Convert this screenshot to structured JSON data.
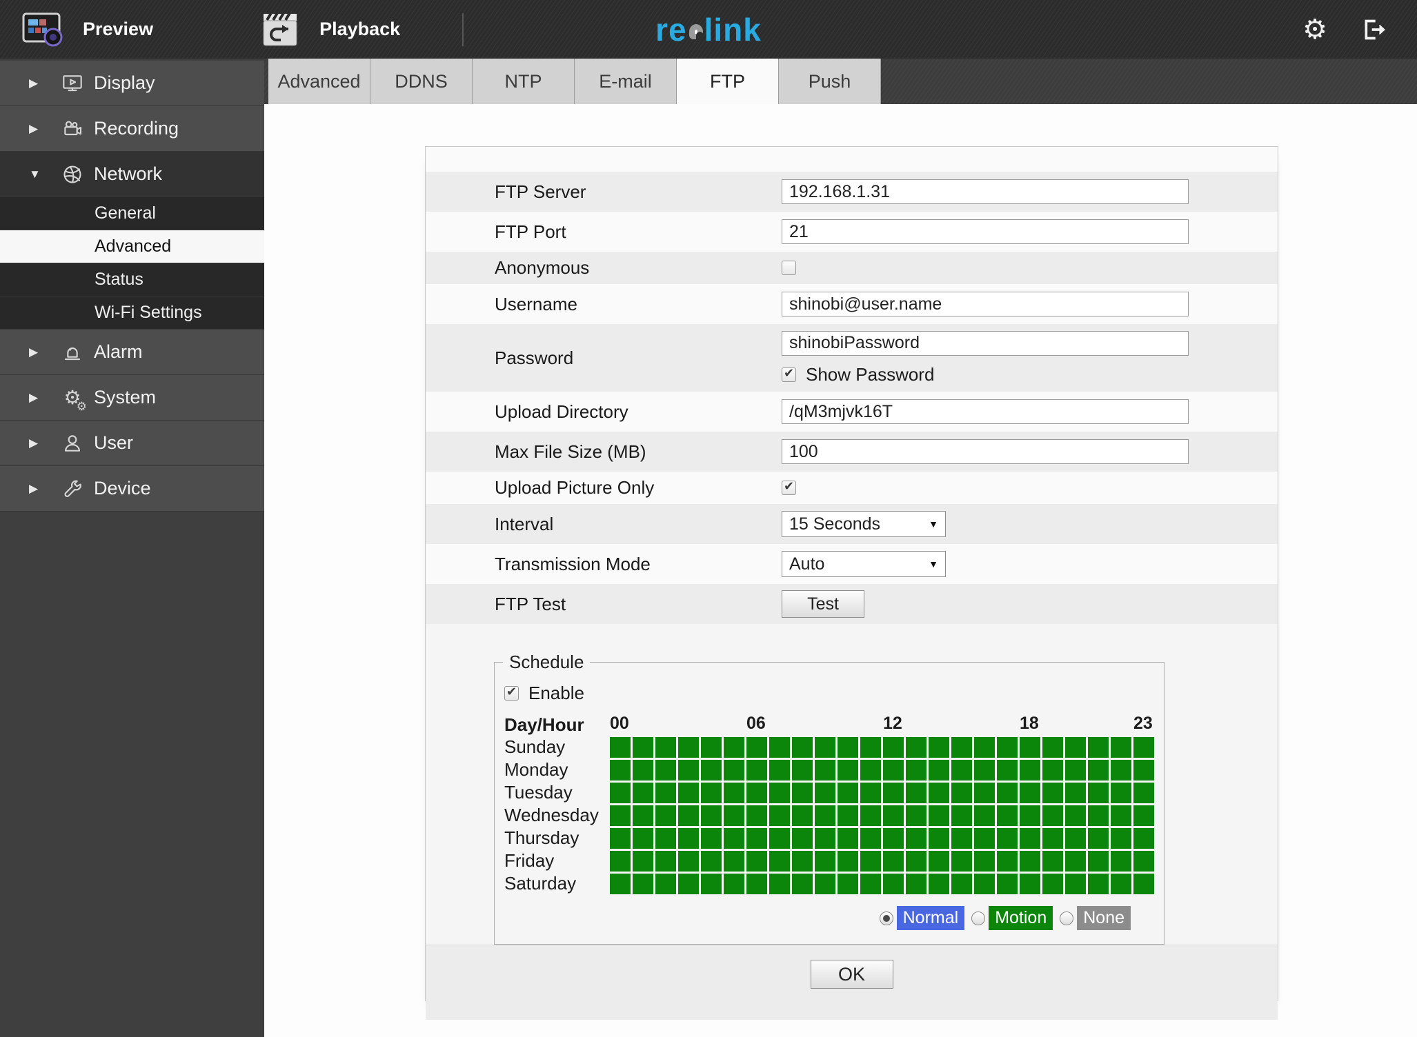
{
  "topbar": {
    "preview_label": "Preview",
    "playback_label": "Playback",
    "logo_re": "re",
    "logo_link": "link"
  },
  "sidebar": {
    "items": [
      {
        "label": "Display",
        "icon": "display",
        "expanded": false
      },
      {
        "label": "Recording",
        "icon": "recording",
        "expanded": false
      },
      {
        "label": "Network",
        "icon": "network",
        "expanded": true,
        "children": [
          {
            "label": "General",
            "active": false
          },
          {
            "label": "Advanced",
            "active": true
          },
          {
            "label": "Status",
            "active": false
          },
          {
            "label": "Wi-Fi Settings",
            "active": false
          }
        ]
      },
      {
        "label": "Alarm",
        "icon": "alarm",
        "expanded": false
      },
      {
        "label": "System",
        "icon": "system",
        "expanded": false
      },
      {
        "label": "User",
        "icon": "user",
        "expanded": false
      },
      {
        "label": "Device",
        "icon": "device",
        "expanded": false
      }
    ]
  },
  "tabs": {
    "active": "FTP",
    "items": [
      "Advanced",
      "DDNS",
      "NTP",
      "E-mail",
      "FTP",
      "Push"
    ]
  },
  "form": {
    "rows": [
      {
        "id": "ftp-server",
        "label": "FTP Server",
        "type": "text",
        "value": "192.168.1.31"
      },
      {
        "id": "ftp-port",
        "label": "FTP Port",
        "type": "text",
        "value": "21"
      },
      {
        "id": "anonymous",
        "label": "Anonymous",
        "type": "checkbox",
        "checked": false
      },
      {
        "id": "username",
        "label": "Username",
        "type": "text",
        "value": "shinobi@user.name"
      },
      {
        "id": "password",
        "label": "Password",
        "type": "password",
        "value": "shinobiPassword",
        "sub_label": "Show Password",
        "sub_checked": true
      },
      {
        "id": "upload-directory",
        "label": "Upload Directory",
        "type": "text",
        "value": "/qM3mjvk16T"
      },
      {
        "id": "max-file-size",
        "label": "Max File Size (MB)",
        "type": "text",
        "value": "100"
      },
      {
        "id": "upload-picture-only",
        "label": "Upload Picture Only",
        "type": "checkbox",
        "checked": true
      },
      {
        "id": "interval",
        "label": "Interval",
        "type": "select",
        "value": "15 Seconds"
      },
      {
        "id": "transmission-mode",
        "label": "Transmission Mode",
        "type": "select",
        "value": "Auto"
      },
      {
        "id": "ftp-test",
        "label": "FTP Test",
        "type": "button",
        "value": "Test"
      }
    ]
  },
  "schedule": {
    "legend": "Schedule",
    "enable_label": "Enable",
    "enabled": true,
    "corner_label": "Day/Hour",
    "columns": 24,
    "hour_labels": [
      {
        "text": "00",
        "col": 0
      },
      {
        "text": "06",
        "col": 6
      },
      {
        "text": "12",
        "col": 12
      },
      {
        "text": "18",
        "col": 18
      },
      {
        "text": "23",
        "col": 23
      }
    ],
    "days": [
      "Sunday",
      "Monday",
      "Tuesday",
      "Wednesday",
      "Thursday",
      "Friday",
      "Saturday"
    ],
    "all_cells_mode": "motion",
    "modes": [
      {
        "label": "Normal",
        "color": "#4a67e2",
        "selected": true
      },
      {
        "label": "Motion",
        "color": "#0b860b",
        "selected": false
      },
      {
        "label": "None",
        "color": "#8c8c8c",
        "selected": false
      }
    ]
  },
  "ok_label": "OK",
  "colors": {
    "accent_logo": "#29abe2",
    "schedule_green": "#0b860b",
    "normal_blue": "#4a67e2",
    "none_gray": "#8c8c8c"
  }
}
